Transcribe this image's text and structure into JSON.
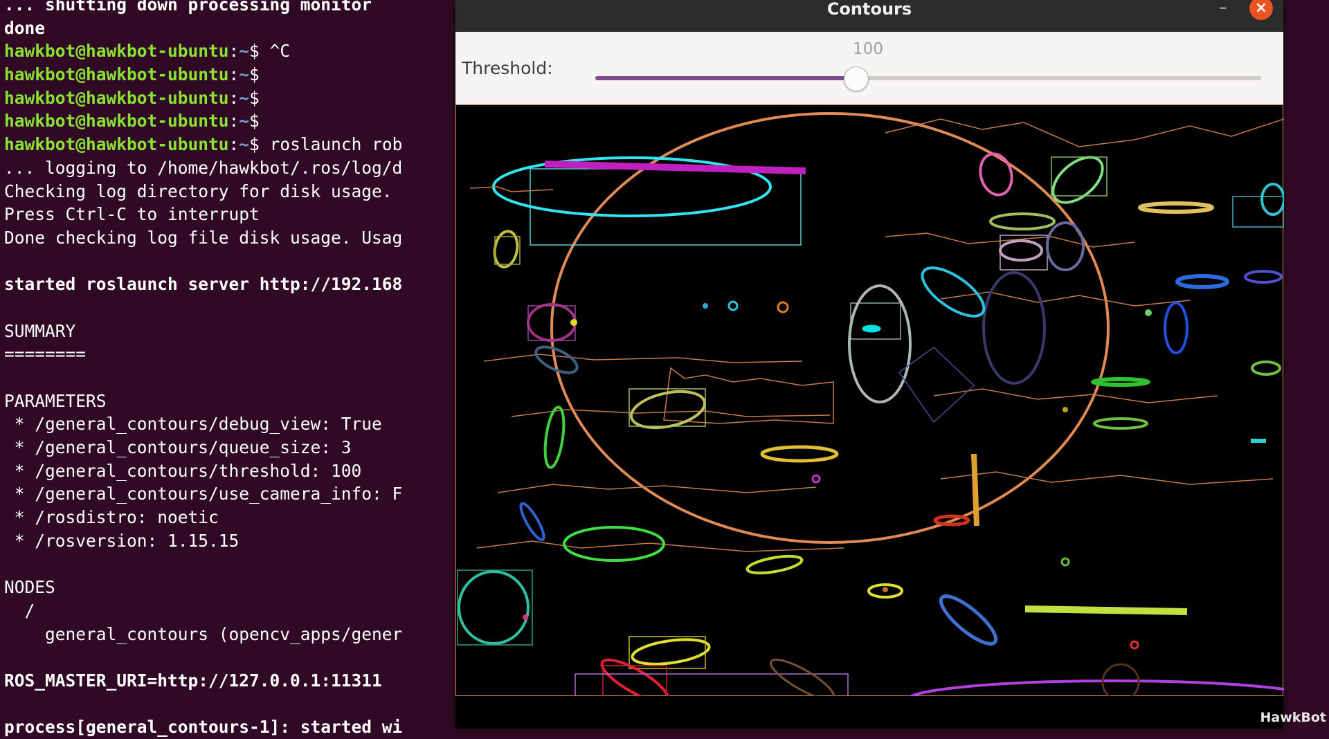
{
  "terminal": {
    "prompt_user": "hawkbot@hawkbot-ubuntu",
    "prompt_path": "~",
    "lines": [
      {
        "kind": "text",
        "bold": true,
        "text": "... shutting down processing monitor"
      },
      {
        "kind": "text",
        "bold": true,
        "text": "done"
      },
      {
        "kind": "prompt",
        "cmd": " ^C"
      },
      {
        "kind": "prompt",
        "cmd": ""
      },
      {
        "kind": "prompt",
        "cmd": ""
      },
      {
        "kind": "prompt",
        "cmd": ""
      },
      {
        "kind": "prompt",
        "cmd": " roslaunch rob"
      },
      {
        "kind": "text",
        "bold": false,
        "text": "... logging to /home/hawkbot/.ros/log/d"
      },
      {
        "kind": "text",
        "bold": false,
        "text": "Checking log directory for disk usage."
      },
      {
        "kind": "text",
        "bold": false,
        "text": "Press Ctrl-C to interrupt"
      },
      {
        "kind": "text",
        "bold": false,
        "text": "Done checking log file disk usage. Usag"
      },
      {
        "kind": "text",
        "bold": false,
        "text": ""
      },
      {
        "kind": "text",
        "bold": true,
        "text": "started roslaunch server http://192.168"
      },
      {
        "kind": "text",
        "bold": false,
        "text": ""
      },
      {
        "kind": "text",
        "bold": false,
        "text": "SUMMARY"
      },
      {
        "kind": "text",
        "bold": false,
        "text": "========"
      },
      {
        "kind": "text",
        "bold": false,
        "text": ""
      },
      {
        "kind": "text",
        "bold": false,
        "text": "PARAMETERS"
      },
      {
        "kind": "text",
        "bold": false,
        "text": " * /general_contours/debug_view: True"
      },
      {
        "kind": "text",
        "bold": false,
        "text": " * /general_contours/queue_size: 3"
      },
      {
        "kind": "text",
        "bold": false,
        "text": " * /general_contours/threshold: 100"
      },
      {
        "kind": "text",
        "bold": false,
        "text": " * /general_contours/use_camera_info: F"
      },
      {
        "kind": "text",
        "bold": false,
        "text": " * /rosdistro: noetic"
      },
      {
        "kind": "text",
        "bold": false,
        "text": " * /rosversion: 1.15.15"
      },
      {
        "kind": "text",
        "bold": false,
        "text": ""
      },
      {
        "kind": "text",
        "bold": false,
        "text": "NODES"
      },
      {
        "kind": "text",
        "bold": false,
        "text": "  /"
      },
      {
        "kind": "text",
        "bold": false,
        "text": "    general_contours (opencv_apps/gener"
      },
      {
        "kind": "text",
        "bold": false,
        "text": ""
      },
      {
        "kind": "text",
        "bold": true,
        "text": "ROS_MASTER_URI=http://127.0.0.1:11311"
      },
      {
        "kind": "text",
        "bold": false,
        "text": ""
      },
      {
        "kind": "text",
        "bold": true,
        "text": "process[general_contours-1]: started wi"
      }
    ]
  },
  "window": {
    "title": "Contours",
    "minimize_icon": "minimize-icon",
    "close_icon": "close-icon",
    "close_color": "#e95420"
  },
  "threshold": {
    "label": "Threshold:",
    "value": "100",
    "fraction": 0.392,
    "fill_color": "#7e4c8e"
  },
  "watermark": "HawkBot"
}
